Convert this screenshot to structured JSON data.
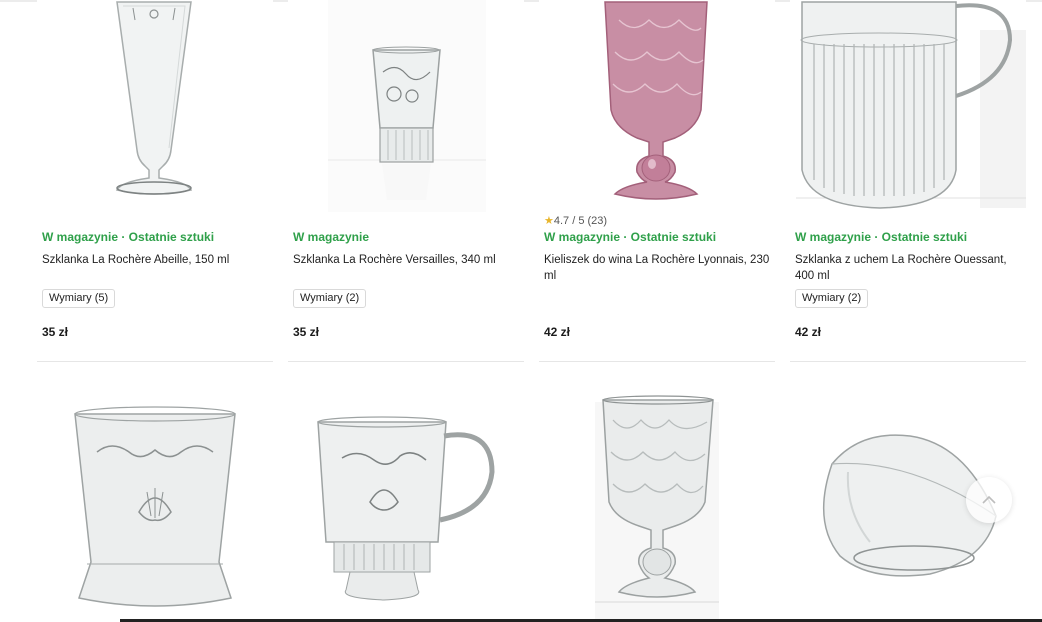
{
  "colors": {
    "stock": "#2fa04a",
    "star": "#e8b52b",
    "heart_active": "#e34b4b",
    "heart_outline": "#9a9a9a"
  },
  "products": [
    {
      "stock": "W magazynie · Ostatnie sztuki",
      "title": "Szklanka La Rochère Abeille, 150 ml",
      "variants": "Wymiary (5)",
      "price": "35 zł"
    },
    {
      "stock": "W magazynie",
      "title": "Szklanka La Rochère Versailles, 340 ml",
      "variants": "Wymiary (2)",
      "price": "35 zł"
    },
    {
      "rating": "4.7 / 5 (23)",
      "stock": "W magazynie · Ostatnie sztuki",
      "title": "Kieliszek do wina La Rochère Lyonnais, 230 ml",
      "price": "42 zł"
    },
    {
      "stock": "W magazynie · Ostatnie sztuki",
      "title": "Szklanka z uchem La Rochère Ouessant, 400 ml",
      "variants": "Wymiary (2)",
      "price": "42 zł"
    }
  ],
  "row2_icons": [
    "heart-filled-icon",
    "heart-outline-icon",
    "heart-outline-icon",
    "heart-outline-icon"
  ],
  "scroll_top_icon": "chevron-up-icon"
}
